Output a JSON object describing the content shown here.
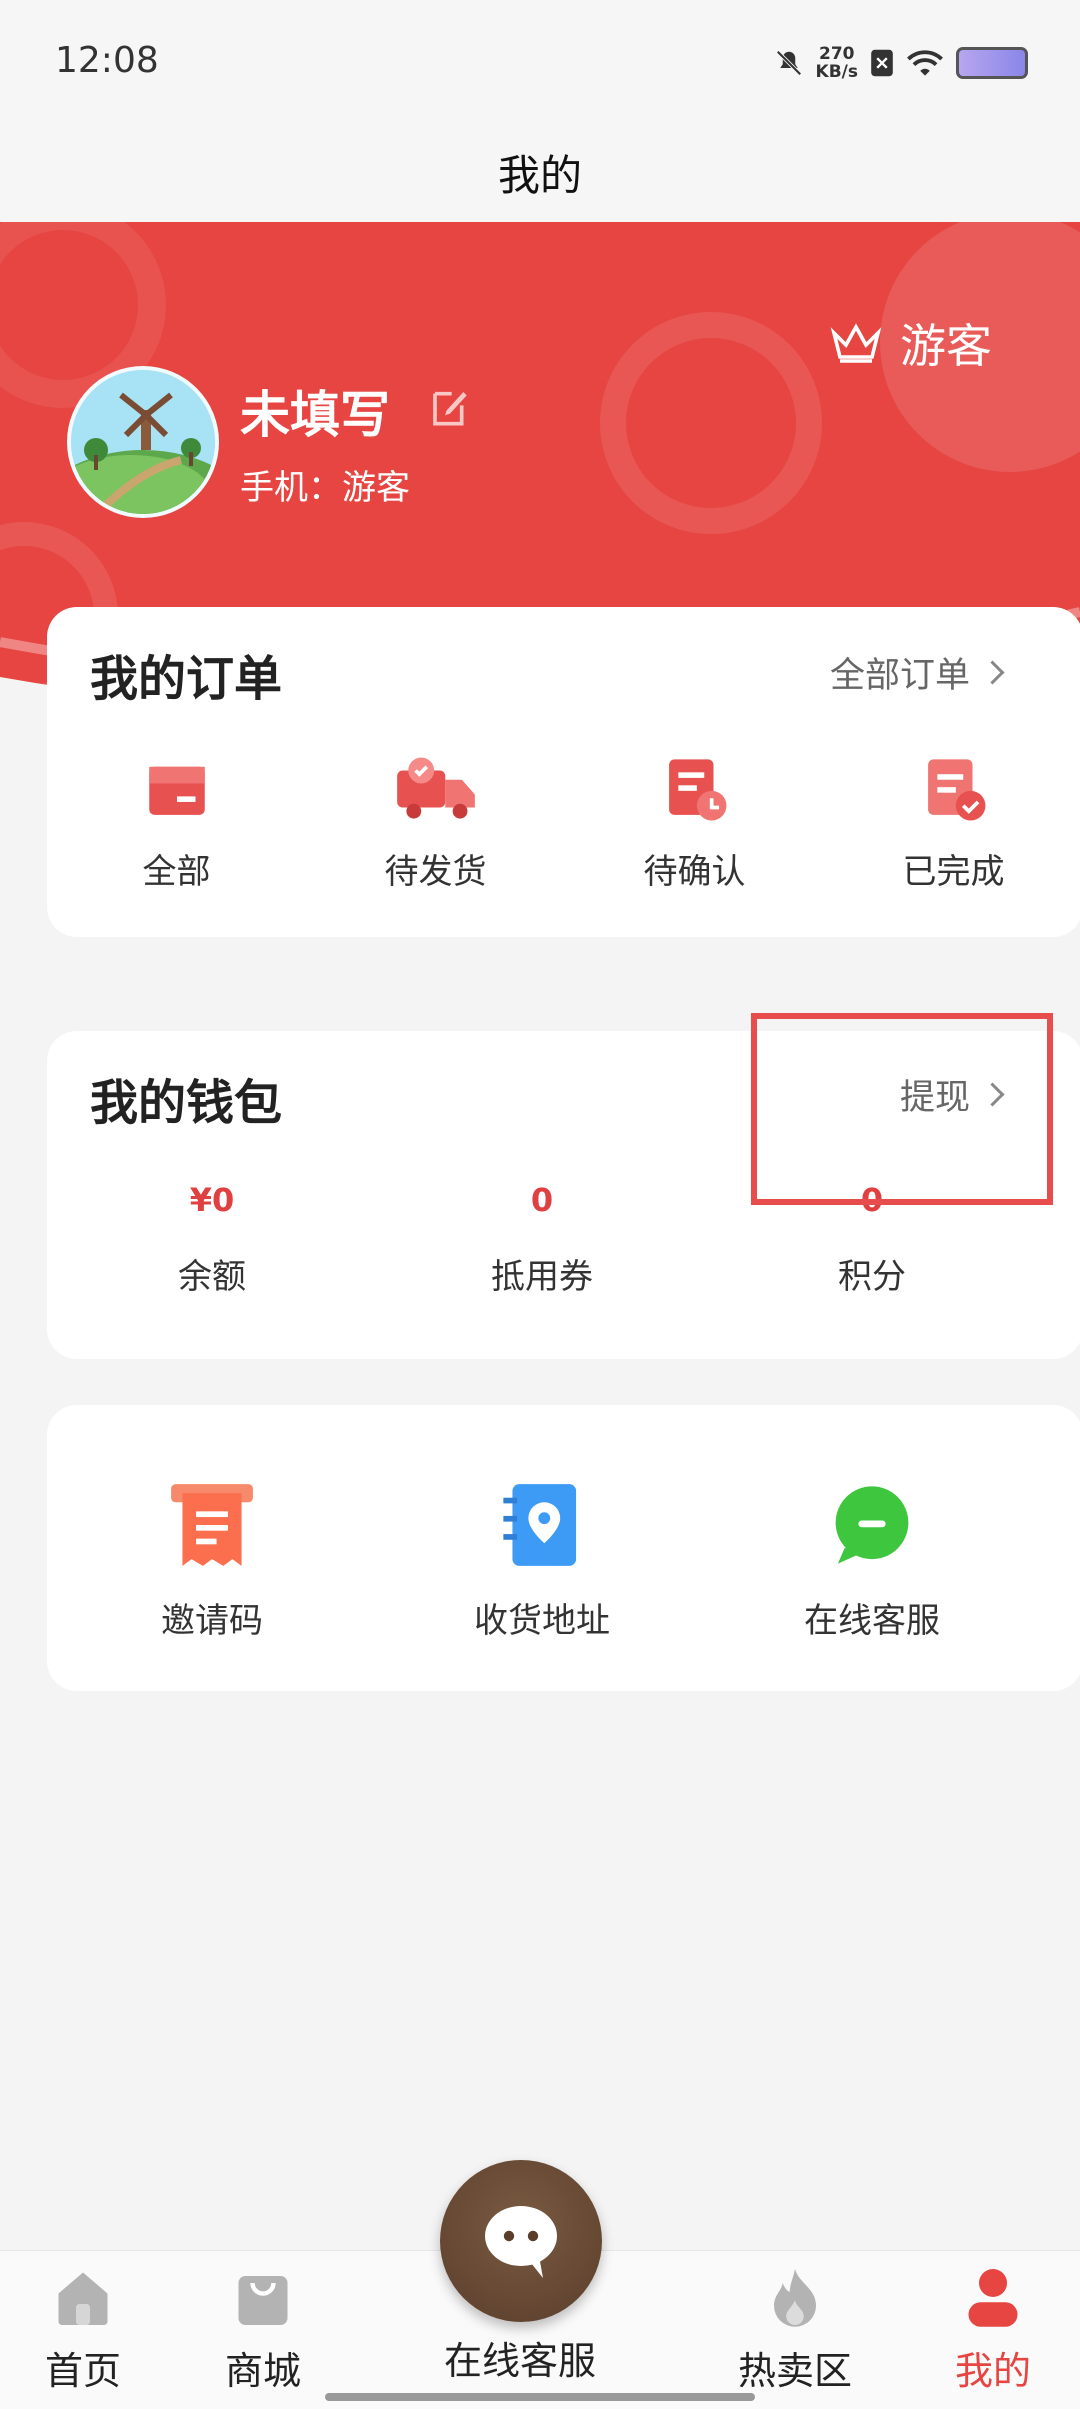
{
  "status_bar": {
    "time": "12:08",
    "speed_value": "270",
    "speed_unit": "KB/s"
  },
  "page_title": "我的",
  "profile": {
    "name": "未填写",
    "phone": "手机：游客",
    "member_level": "游客"
  },
  "orders": {
    "title": "我的订单",
    "all_link": "全部订单",
    "items": [
      {
        "label": "全部",
        "icon": "box-icon"
      },
      {
        "label": "待发货",
        "icon": "truck-icon"
      },
      {
        "label": "待确认",
        "icon": "clock-doc-icon"
      },
      {
        "label": "已完成",
        "icon": "check-doc-icon"
      }
    ]
  },
  "wallet": {
    "title": "我的钱包",
    "withdraw_link": "提现",
    "items": [
      {
        "value": "¥0",
        "label": "余额"
      },
      {
        "value": "0",
        "label": "抵用券"
      },
      {
        "value": "0",
        "label": "积分"
      }
    ]
  },
  "services": {
    "items": [
      {
        "label": "邀请码",
        "icon": "receipt-icon"
      },
      {
        "label": "收货地址",
        "icon": "location-book-icon"
      },
      {
        "label": "在线客服",
        "icon": "chat-icon"
      }
    ]
  },
  "bottom_nav": {
    "items": [
      {
        "label": "首页",
        "icon": "home-icon"
      },
      {
        "label": "商城",
        "icon": "bag-icon"
      },
      {
        "label": "在线客服",
        "icon": "chat-bubble-icon"
      },
      {
        "label": "热卖区",
        "icon": "fire-icon"
      },
      {
        "label": "我的",
        "icon": "user-icon"
      }
    ],
    "active_color": "#e64541"
  }
}
